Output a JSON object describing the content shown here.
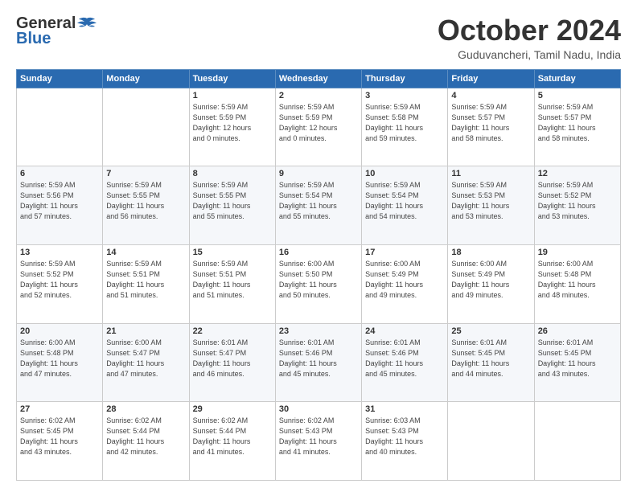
{
  "header": {
    "logo_general": "General",
    "logo_blue": "Blue",
    "month": "October 2024",
    "location": "Guduvancheri, Tamil Nadu, India"
  },
  "weekdays": [
    "Sunday",
    "Monday",
    "Tuesday",
    "Wednesday",
    "Thursday",
    "Friday",
    "Saturday"
  ],
  "weeks": [
    [
      {
        "day": "",
        "info": ""
      },
      {
        "day": "",
        "info": ""
      },
      {
        "day": "1",
        "info": "Sunrise: 5:59 AM\nSunset: 5:59 PM\nDaylight: 12 hours\nand 0 minutes."
      },
      {
        "day": "2",
        "info": "Sunrise: 5:59 AM\nSunset: 5:59 PM\nDaylight: 12 hours\nand 0 minutes."
      },
      {
        "day": "3",
        "info": "Sunrise: 5:59 AM\nSunset: 5:58 PM\nDaylight: 11 hours\nand 59 minutes."
      },
      {
        "day": "4",
        "info": "Sunrise: 5:59 AM\nSunset: 5:57 PM\nDaylight: 11 hours\nand 58 minutes."
      },
      {
        "day": "5",
        "info": "Sunrise: 5:59 AM\nSunset: 5:57 PM\nDaylight: 11 hours\nand 58 minutes."
      }
    ],
    [
      {
        "day": "6",
        "info": "Sunrise: 5:59 AM\nSunset: 5:56 PM\nDaylight: 11 hours\nand 57 minutes."
      },
      {
        "day": "7",
        "info": "Sunrise: 5:59 AM\nSunset: 5:55 PM\nDaylight: 11 hours\nand 56 minutes."
      },
      {
        "day": "8",
        "info": "Sunrise: 5:59 AM\nSunset: 5:55 PM\nDaylight: 11 hours\nand 55 minutes."
      },
      {
        "day": "9",
        "info": "Sunrise: 5:59 AM\nSunset: 5:54 PM\nDaylight: 11 hours\nand 55 minutes."
      },
      {
        "day": "10",
        "info": "Sunrise: 5:59 AM\nSunset: 5:54 PM\nDaylight: 11 hours\nand 54 minutes."
      },
      {
        "day": "11",
        "info": "Sunrise: 5:59 AM\nSunset: 5:53 PM\nDaylight: 11 hours\nand 53 minutes."
      },
      {
        "day": "12",
        "info": "Sunrise: 5:59 AM\nSunset: 5:52 PM\nDaylight: 11 hours\nand 53 minutes."
      }
    ],
    [
      {
        "day": "13",
        "info": "Sunrise: 5:59 AM\nSunset: 5:52 PM\nDaylight: 11 hours\nand 52 minutes."
      },
      {
        "day": "14",
        "info": "Sunrise: 5:59 AM\nSunset: 5:51 PM\nDaylight: 11 hours\nand 51 minutes."
      },
      {
        "day": "15",
        "info": "Sunrise: 5:59 AM\nSunset: 5:51 PM\nDaylight: 11 hours\nand 51 minutes."
      },
      {
        "day": "16",
        "info": "Sunrise: 6:00 AM\nSunset: 5:50 PM\nDaylight: 11 hours\nand 50 minutes."
      },
      {
        "day": "17",
        "info": "Sunrise: 6:00 AM\nSunset: 5:49 PM\nDaylight: 11 hours\nand 49 minutes."
      },
      {
        "day": "18",
        "info": "Sunrise: 6:00 AM\nSunset: 5:49 PM\nDaylight: 11 hours\nand 49 minutes."
      },
      {
        "day": "19",
        "info": "Sunrise: 6:00 AM\nSunset: 5:48 PM\nDaylight: 11 hours\nand 48 minutes."
      }
    ],
    [
      {
        "day": "20",
        "info": "Sunrise: 6:00 AM\nSunset: 5:48 PM\nDaylight: 11 hours\nand 47 minutes."
      },
      {
        "day": "21",
        "info": "Sunrise: 6:00 AM\nSunset: 5:47 PM\nDaylight: 11 hours\nand 47 minutes."
      },
      {
        "day": "22",
        "info": "Sunrise: 6:01 AM\nSunset: 5:47 PM\nDaylight: 11 hours\nand 46 minutes."
      },
      {
        "day": "23",
        "info": "Sunrise: 6:01 AM\nSunset: 5:46 PM\nDaylight: 11 hours\nand 45 minutes."
      },
      {
        "day": "24",
        "info": "Sunrise: 6:01 AM\nSunset: 5:46 PM\nDaylight: 11 hours\nand 45 minutes."
      },
      {
        "day": "25",
        "info": "Sunrise: 6:01 AM\nSunset: 5:45 PM\nDaylight: 11 hours\nand 44 minutes."
      },
      {
        "day": "26",
        "info": "Sunrise: 6:01 AM\nSunset: 5:45 PM\nDaylight: 11 hours\nand 43 minutes."
      }
    ],
    [
      {
        "day": "27",
        "info": "Sunrise: 6:02 AM\nSunset: 5:45 PM\nDaylight: 11 hours\nand 43 minutes."
      },
      {
        "day": "28",
        "info": "Sunrise: 6:02 AM\nSunset: 5:44 PM\nDaylight: 11 hours\nand 42 minutes."
      },
      {
        "day": "29",
        "info": "Sunrise: 6:02 AM\nSunset: 5:44 PM\nDaylight: 11 hours\nand 41 minutes."
      },
      {
        "day": "30",
        "info": "Sunrise: 6:02 AM\nSunset: 5:43 PM\nDaylight: 11 hours\nand 41 minutes."
      },
      {
        "day": "31",
        "info": "Sunrise: 6:03 AM\nSunset: 5:43 PM\nDaylight: 11 hours\nand 40 minutes."
      },
      {
        "day": "",
        "info": ""
      },
      {
        "day": "",
        "info": ""
      }
    ]
  ]
}
